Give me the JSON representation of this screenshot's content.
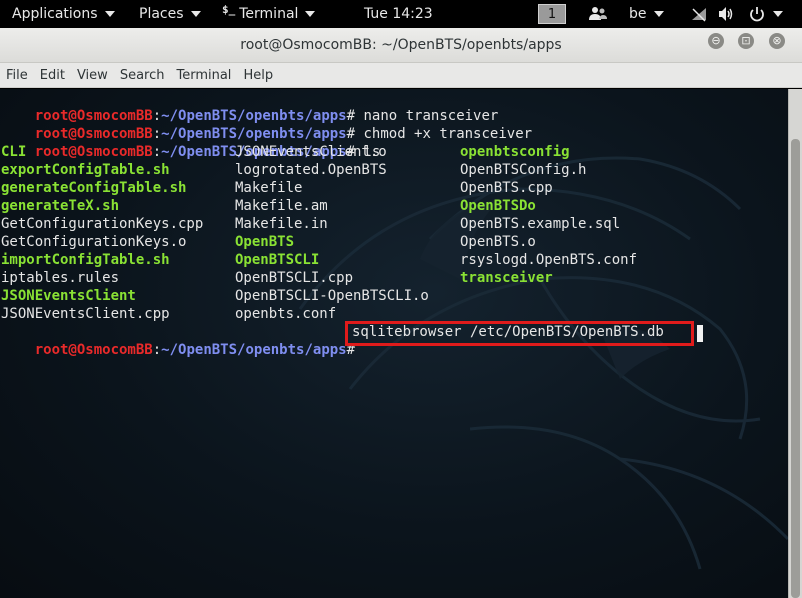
{
  "panel": {
    "applications": "Applications",
    "places": "Places",
    "terminal_glyph": "$_",
    "terminal": "Terminal",
    "clock": "Tue 14:23",
    "workspace": "1",
    "keyboard_layout": "be"
  },
  "window": {
    "title": "root@OsmocomBB: ~/OpenBTS/openbts/apps",
    "minimize": "⊖",
    "maximize": "⊡",
    "close": "⊗"
  },
  "menu": [
    "File",
    "Edit",
    "View",
    "Search",
    "Terminal",
    "Help"
  ],
  "prompt": {
    "user": "root@OsmocomBB",
    "sep": ":",
    "path": "~/OpenBTS/openbts/apps",
    "symbol": "#"
  },
  "commands": [
    " nano transceiver",
    " chmod +x transceiver",
    " ls"
  ],
  "ls_rows": [
    [
      {
        "t": "CLI",
        "x": true
      },
      {
        "t": "JSONEventsClient.o",
        "x": false
      },
      {
        "t": "openbtsconfig",
        "x": true
      }
    ],
    [
      {
        "t": "exportConfigTable.sh",
        "x": true
      },
      {
        "t": "logrotated.OpenBTS",
        "x": false
      },
      {
        "t": "OpenBTSConfig.h",
        "x": false
      }
    ],
    [
      {
        "t": "generateConfigTable.sh",
        "x": true
      },
      {
        "t": "Makefile",
        "x": false
      },
      {
        "t": "OpenBTS.cpp",
        "x": false
      }
    ],
    [
      {
        "t": "generateTeX.sh",
        "x": true
      },
      {
        "t": "Makefile.am",
        "x": false
      },
      {
        "t": "OpenBTSDo",
        "x": true
      }
    ],
    [
      {
        "t": "GetConfigurationKeys.cpp",
        "x": false
      },
      {
        "t": "Makefile.in",
        "x": false
      },
      {
        "t": "OpenBTS.example.sql",
        "x": false
      }
    ],
    [
      {
        "t": "GetConfigurationKeys.o",
        "x": false
      },
      {
        "t": "OpenBTS",
        "x": true
      },
      {
        "t": "OpenBTS.o",
        "x": false
      }
    ],
    [
      {
        "t": "importConfigTable.sh",
        "x": true
      },
      {
        "t": "OpenBTSCLI",
        "x": true
      },
      {
        "t": "rsyslogd.OpenBTS.conf",
        "x": false
      }
    ],
    [
      {
        "t": "iptables.rules",
        "x": false
      },
      {
        "t": "OpenBTSCLI.cpp",
        "x": false
      },
      {
        "t": "transceiver",
        "x": true
      }
    ],
    [
      {
        "t": "JSONEventsClient",
        "x": true
      },
      {
        "t": "OpenBTSCLI-OpenBTSCLI.o",
        "x": false
      },
      {
        "t": "",
        "x": false
      }
    ],
    [
      {
        "t": "JSONEventsClient.cpp",
        "x": false
      },
      {
        "t": "openbts.conf",
        "x": false
      },
      {
        "t": "",
        "x": false
      }
    ]
  ],
  "current_command": "sqlitebrowser /etc/OpenBTS/OpenBTS.db",
  "colors": {
    "prompt_user": "#ea2a2a",
    "prompt_path": "#7f8ef0",
    "executable": "#8ae234",
    "highlight_box": "#e01b1b"
  }
}
